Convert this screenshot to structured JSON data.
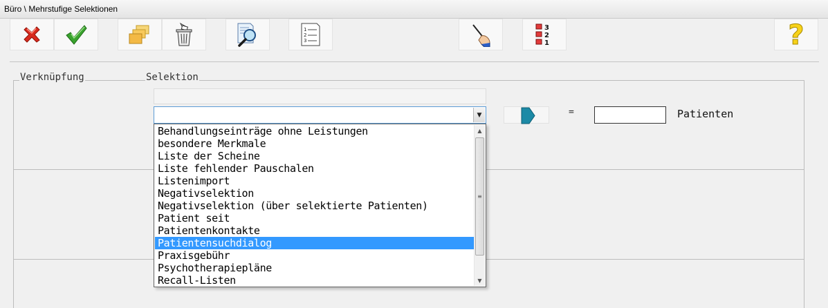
{
  "window": {
    "title": "Büro \\ Mehrstufige Selektionen"
  },
  "toolbar": {
    "buttons": [
      {
        "name": "cancel",
        "icon": "red-x-icon"
      },
      {
        "name": "ok",
        "icon": "green-check-icon"
      },
      {
        "name": "folders",
        "icon": "stacked-folders-icon"
      },
      {
        "name": "trash",
        "icon": "trash-can-icon"
      },
      {
        "name": "search",
        "icon": "magnifier-document-icon"
      },
      {
        "name": "list",
        "icon": "numbered-list-icon"
      },
      {
        "name": "edit",
        "icon": "writing-hand-icon"
      },
      {
        "name": "priority",
        "icon": "priority-321-icon"
      },
      {
        "name": "help",
        "icon": "question-mark-icon"
      }
    ],
    "priority_numbers": [
      "3",
      "2",
      "1"
    ],
    "list_numbers": [
      "1",
      "2",
      "3"
    ],
    "help_glyph": "?"
  },
  "groups": {
    "link_label": "Verknüpfung",
    "selection_label": "Selektion"
  },
  "selection": {
    "value": "",
    "equals": "=",
    "patient_count": "",
    "patients_label": "Patienten",
    "options": [
      "Behandlungseinträge ohne Leistungen",
      "besondere Merkmale",
      "Liste der Scheine",
      "Liste fehlender Pauschalen",
      "Listenimport",
      "Negativselektion",
      "Negativselektion (über selektierte Patienten)",
      "Patient seit",
      "Patientenkontakte",
      "Patientensuchdialog",
      "Praxisgebühr",
      "Psychotherapiepläne",
      "Recall-Listen"
    ],
    "highlighted": "Patientensuchdialog"
  },
  "colors": {
    "highlight": "#3399ff",
    "accent": "#5b9bd5",
    "arrow": "#1c8aa6"
  }
}
